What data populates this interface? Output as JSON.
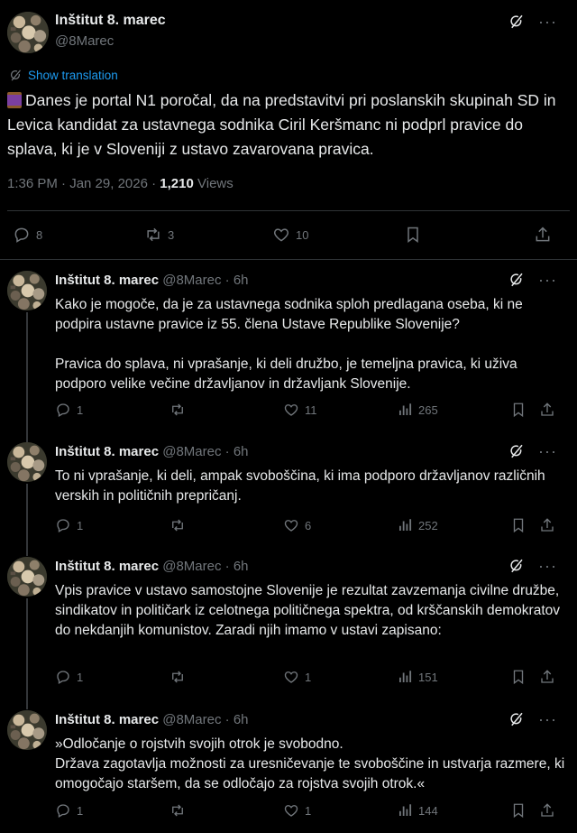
{
  "main_tweet": {
    "name": "Inštitut 8. marec",
    "handle": "@8Marec",
    "show_translation": "Show translation",
    "text": "Danes je portal N1 poročal, da na predstavitvi pri poslanskih skupinah SD in Levica kandidat za ustavnega sodnika Ciril Keršmanc ni podprl pravice do splava, ki je v Sloveniji z ustavo zavarovana pravica.",
    "time": "1:36 PM · Jan 29, 2026 ·",
    "views_count": "1,210",
    "views_label": "Views",
    "replies": "8",
    "reposts": "3",
    "likes": "10"
  },
  "replies": [
    {
      "name": "Inštitut 8. marec",
      "handle": "@8Marec",
      "sep": "·",
      "time": "6h",
      "paragraphs": [
        "Kako je mogoče, da je za ustavnega sodnika sploh predlagana oseba, ki ne podpira ustavne pravice iz 55. člena Ustave Republike Slovenije?",
        "Pravica do splava, ni vprašanje, ki deli družbo, je temeljna pravica, ki uživa podporo velike večine državljanov in državljank Slovenije."
      ],
      "replies": "1",
      "reposts": "",
      "likes": "11",
      "views": "265"
    },
    {
      "name": "Inštitut 8. marec",
      "handle": "@8Marec",
      "sep": "·",
      "time": "6h",
      "paragraphs": [
        "To ni vprašanje, ki deli, ampak svoboščina, ki ima podporo državljanov različnih verskih in političnih prepričanj."
      ],
      "replies": "1",
      "reposts": "",
      "likes": "6",
      "views": "252"
    },
    {
      "name": "Inštitut 8. marec",
      "handle": "@8Marec",
      "sep": "·",
      "time": "6h",
      "paragraphs": [
        "Vpis pravice v ustavo samostojne Slovenije je rezultat zavzemanja civilne družbe, sindikatov in političark iz celotnega političnega spektra, od krščanskih demokratov do nekdanjih komunistov. Zaradi njih imamo v ustavi zapisano:"
      ],
      "replies": "1",
      "reposts": "",
      "likes": "1",
      "views": "151"
    },
    {
      "name": "Inštitut 8. marec",
      "handle": "@8Marec",
      "sep": "·",
      "time": "6h",
      "paragraphs": [
        "»Odločanje o rojstvih svojih otrok je svobodno.",
        "Država zagotavlja možnosti za uresničevanje te svoboščine in ustvarja razmere, ki omogočajo staršem, da se odločajo za rojstva svojih otrok.«"
      ],
      "replies": "1",
      "reposts": "",
      "likes": "1",
      "views": "144"
    }
  ],
  "icons": {
    "grok": "grok-icon",
    "more": "more-icon",
    "translate": "translate-icon",
    "reply": "reply-icon",
    "repost": "repost-icon",
    "like": "like-icon",
    "views": "views-icon",
    "bookmark": "bookmark-icon",
    "share": "share-icon"
  },
  "colors": {
    "background": "#000000",
    "text": "#e7e9ea",
    "muted": "#71767b",
    "link": "#1d9bf0",
    "divider": "#2f3336"
  }
}
